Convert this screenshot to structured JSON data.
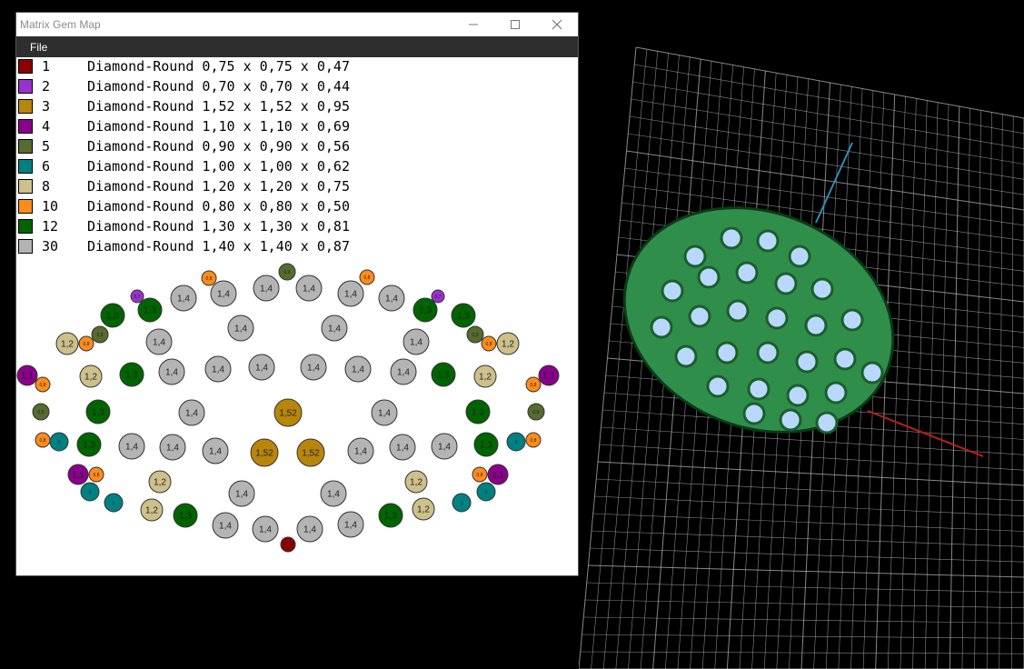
{
  "window": {
    "title": "Matrix Gem Map",
    "menu": {
      "file_label": "File"
    }
  },
  "legend": [
    {
      "count": "1",
      "desc": "Diamond-Round 0,75 x 0,75 x 0,47",
      "color": "#8b0000"
    },
    {
      "count": "2",
      "desc": "Diamond-Round 0,70 x 0,70 x 0,44",
      "color": "#9932cc"
    },
    {
      "count": "3",
      "desc": "Diamond-Round 1,52 x 1,52 x 0,95",
      "color": "#b8860b"
    },
    {
      "count": "4",
      "desc": "Diamond-Round 1,10 x 1,10 x 0,69",
      "color": "#8b008b"
    },
    {
      "count": "5",
      "desc": "Diamond-Round 0,90 x 0,90 x 0,56",
      "color": "#556b2f"
    },
    {
      "count": "6",
      "desc": "Diamond-Round 1,00 x 1,00 x 0,62",
      "color": "#008080"
    },
    {
      "count": "8",
      "desc": "Diamond-Round 1,20 x 1,20 x 0,75",
      "color": "#cdc08a"
    },
    {
      "count": "10",
      "desc": "Diamond-Round 0,80 x 0,80 x 0,50",
      "color": "#ff8c1a"
    },
    {
      "count": "12",
      "desc": "Diamond-Round 1,30 x 1,30 x 0,81",
      "color": "#006400"
    },
    {
      "count": "30",
      "desc": "Diamond-Round 1,40 x 1,40 x 0,87",
      "color": "#b4b4b4"
    }
  ],
  "gem_labels": {
    "d075": "0,75",
    "d070": "0,7",
    "d152": "1,52",
    "d110": "1,1",
    "d090": "0,9",
    "d100": "1",
    "d120": "1,2",
    "d080": "0,8",
    "d130": "1,3",
    "d140": "1,4"
  },
  "viewport": {
    "background": "#000000",
    "grid_color": "#b5b5b5",
    "axis_x_color": "#c0201a",
    "axis_z_color": "#2f8fb5",
    "model_color": "#2f8f4a",
    "stone_color": "#b9d8ff"
  }
}
